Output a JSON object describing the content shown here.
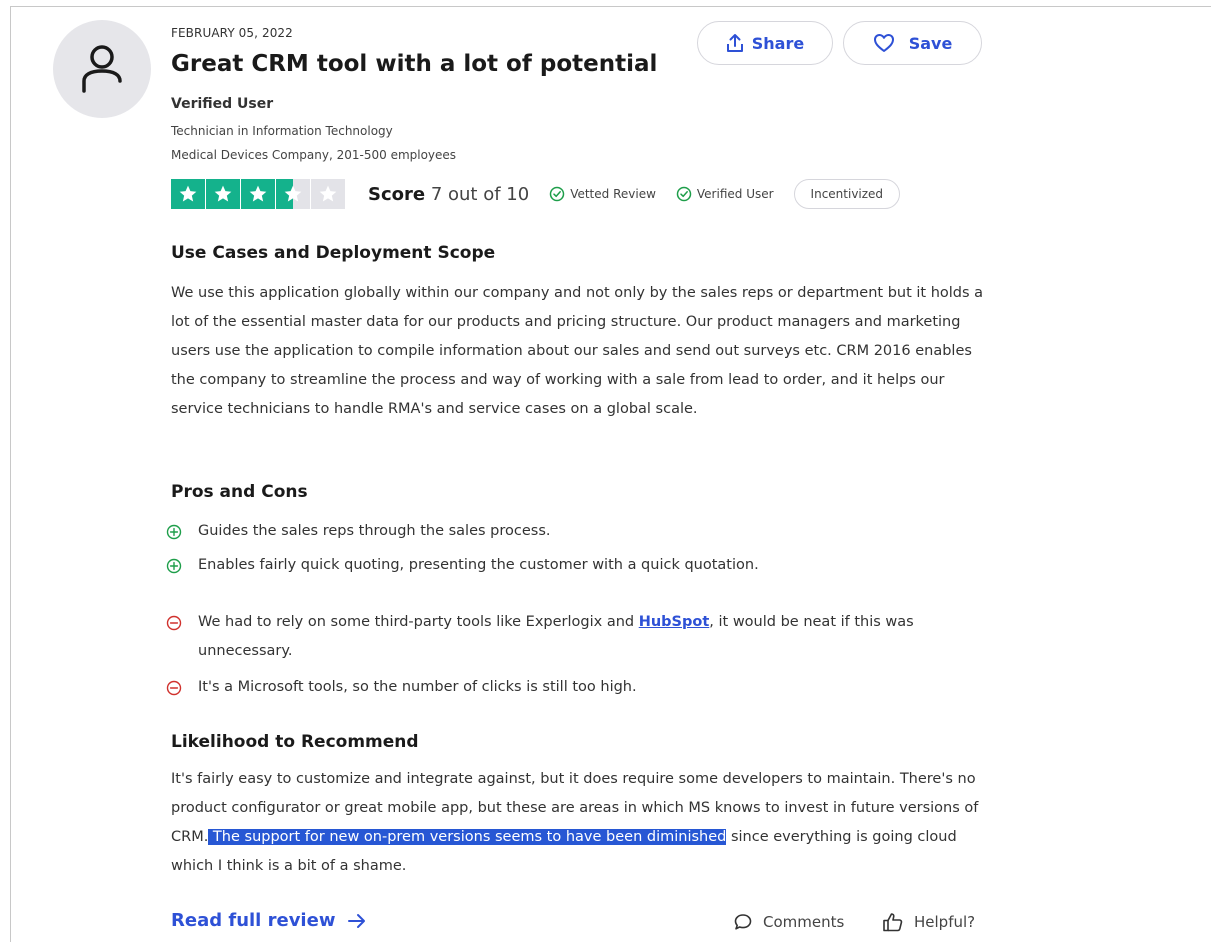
{
  "review": {
    "date": "FEBRUARY 05, 2022",
    "title": "Great CRM tool with a lot of potential",
    "reviewer_name": "Verified User",
    "reviewer_role": "Technician in Information Technology",
    "reviewer_company": "Medical Devices Company, 201-500 employees"
  },
  "actions": {
    "share_label": "Share",
    "save_label": "Save"
  },
  "rating": {
    "stars_filled": 3.5,
    "stars_total": 5,
    "score_label": "Score",
    "score_text": "7 out of 10",
    "vetted_label": "Vetted Review",
    "verified_label": "Verified User",
    "incentivized_label": "Incentivized",
    "star_color": "#14b28c"
  },
  "use_cases": {
    "heading": "Use Cases and Deployment Scope",
    "body": "We use this application globally within our company and not only by the sales reps or department but it holds a lot of the essential master data for our products and pricing structure. Our product managers and marketing users use the application to compile information about our sales and send out surveys etc. CRM 2016 enables the company to streamline the process and way of working with a sale from lead to order, and it helps our service technicians to handle RMA's and service cases on a global scale."
  },
  "pros_cons": {
    "heading": "Pros and Cons",
    "pros": [
      "Guides the sales reps through the sales process.",
      "Enables fairly quick quoting, presenting the customer with a quick quotation."
    ],
    "con1_before": "We had to rely on some third-party tools like Experlogix and ",
    "con1_link": "HubSpot",
    "con1_after": ", it would be neat if this was unnecessary.",
    "con2": "It's a Microsoft tools, so the number of clicks is still too high.",
    "pro_color": "#1e9e4a",
    "con_color": "#d0312d"
  },
  "likelihood": {
    "heading": "Likelihood to Recommend",
    "body_before": "It's fairly easy to customize and integrate against, but it does require some developers to maintain. There's no product configurator or great mobile app, but these are areas in which MS knows to invest in future versions of CRM.",
    "body_highlight": " The support for new on-prem versions seems to have been diminished",
    "body_after": " since everything is going cloud which I think is a bit of a shame."
  },
  "footer": {
    "read_full": "Read full review",
    "comments": "Comments",
    "helpful": "Helpful?"
  },
  "colors": {
    "accent": "#2e51d6",
    "highlight": "#2757d4"
  }
}
